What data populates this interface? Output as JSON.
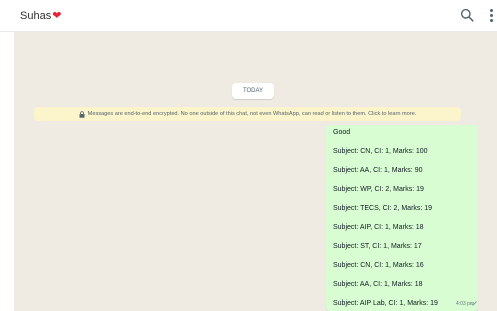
{
  "header": {
    "contact_name": "Suhas",
    "contact_emoji": "❤"
  },
  "chat": {
    "date_label": "TODAY",
    "encryption_notice": "Messages are end-to-end encrypted. No one outside of this chat, not even WhatsApp, can read or listen to them. Click to learn more.",
    "message": {
      "lines": [
        "Good",
        "Subject: CN, CI: 1, Marks: 100",
        "Subject: AA, CI: 1, Marks: 90",
        "Subject: WP, CI: 2, Marks: 19",
        "Subject: TECS, CI: 2, Marks: 19",
        "Subject: AIP, CI: 1, Marks: 18",
        "Subject: ST, CI: 1, Marks: 17",
        "Subject: CN, CI: 1, Marks: 16",
        "Subject: AA, CI: 1, Marks: 18",
        "Subject: AIP Lab, CI: 1, Marks: 19"
      ],
      "time": "4:03 pm"
    }
  },
  "colors": {
    "chat_background": "#efeae2",
    "outgoing_bubble": "#d9fdd3",
    "encryption_banner": "#fcf4cb",
    "heart": "#e52435"
  },
  "icons": {
    "search": "search-icon",
    "menu": "more-vertical-icon",
    "lock": "lock-icon",
    "status": "single-tick-icon"
  }
}
